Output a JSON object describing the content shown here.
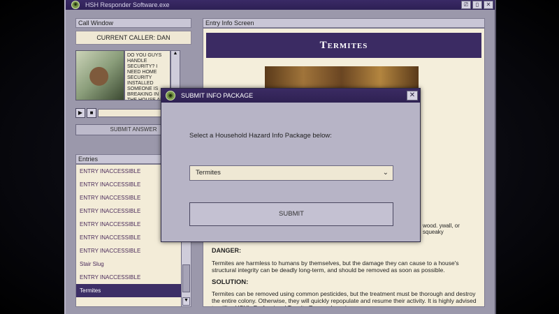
{
  "app": {
    "title": "HSH Responder Software.exe",
    "window_buttons": [
      "⎚",
      "▯",
      "✕"
    ]
  },
  "call_window": {
    "title": "Call Window",
    "current_caller": "CURRENT CALLER: DAN",
    "transcript": "DO YOU GUYS HANDLE SECURITY? I NEED HOME SECURITY INSTALLED SOMEONE IS BREAKING IN THE HOUSE AND G... THROUGH MY...",
    "scroll_up": "▲",
    "play": "▶",
    "stop": "■",
    "submit_answer": "SUBMIT ANSWER"
  },
  "entries": {
    "title": "Entries",
    "items": [
      {
        "label": "ENTRY INACCESSIBLE"
      },
      {
        "label": "ENTRY INACCESSIBLE"
      },
      {
        "label": "ENTRY INACCESSIBLE"
      },
      {
        "label": "ENTRY INACCESSIBLE"
      },
      {
        "label": "ENTRY INACCESSIBLE"
      },
      {
        "label": "ENTRY INACCESSIBLE"
      },
      {
        "label": "ENTRY INACCESSIBLE"
      },
      {
        "label": "Stair Slug"
      },
      {
        "label": "ENTRY INACCESSIBLE"
      },
      {
        "label": "Termites"
      }
    ],
    "selected_index": 9,
    "scroll_down": "▼"
  },
  "entry_info": {
    "title": "Entry Info Screen",
    "heading": "Termites",
    "partial_text": "wood. ywall, or squeaky",
    "danger_label": "DANGER:",
    "danger_text": "Termites are harmless to humans by themselves, but the damage they can cause to a house's structural integrity can be deadly long-term, and should be removed as soon as possible.",
    "solution_label": "SOLUTION:",
    "solution_text": "Termites can be removed using common pesticides, but the treatment must be thorough and destroy the entire colony. Otherwise, they will quickly repopulate and resume their activity. It is highly advised to utilize HSH's Professional Termite Removal services."
  },
  "modal": {
    "title": "SUBMIT INFO PACKAGE",
    "close": "✕",
    "prompt": "Select a Household Hazard Info Package below:",
    "selected_option": "Termites",
    "chevron": "⌄",
    "submit": "SUBMIT"
  }
}
